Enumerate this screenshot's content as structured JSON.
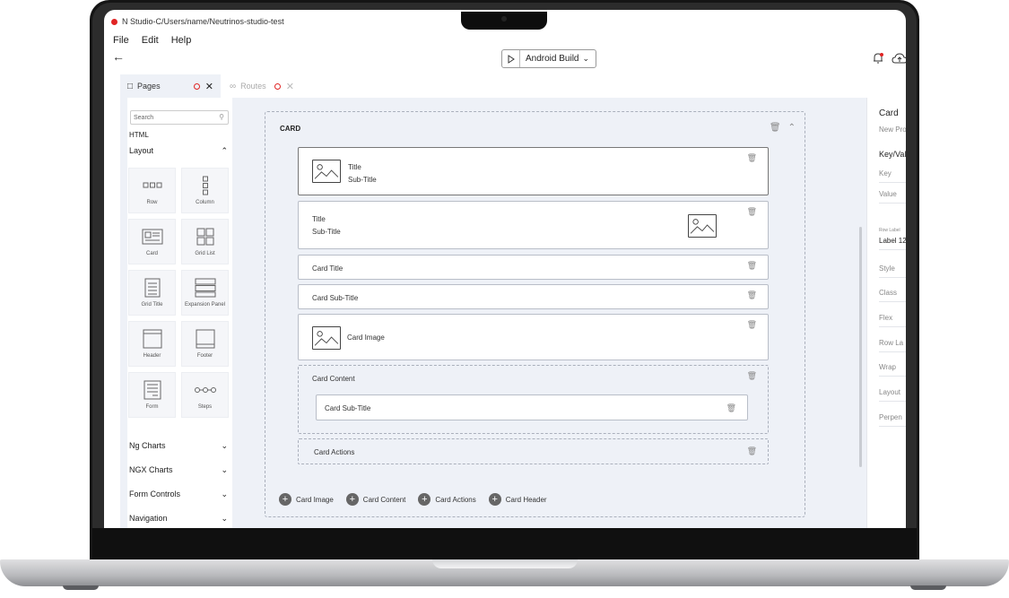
{
  "window": {
    "title": "N Studio-C/Users/name/Neutrinos-studio-test"
  },
  "menu": [
    "File",
    "Edit",
    "Help"
  ],
  "toolbar": {
    "build_label": "Android Build"
  },
  "tabs": [
    {
      "label": "Pages",
      "active": true
    },
    {
      "label": "Routes",
      "active": false
    }
  ],
  "left_panel": {
    "search_placeholder": "Search",
    "html_label": "HTML",
    "layout_label": "Layout",
    "components": [
      "Row",
      "Column",
      "Card",
      "Grid List",
      "Grid Title",
      "Expansion Panel",
      "Header",
      "Footer",
      "Form",
      "Steps"
    ],
    "sections": [
      "Ng Charts",
      "NGX Charts",
      "Form Controls",
      "Navigation"
    ]
  },
  "canvas": {
    "card_label": "CARD",
    "blocks": {
      "header1_title": "Title",
      "header1_subtitle": "Sub-Title",
      "header2_title": "Title",
      "header2_subtitle": "Sub-Title",
      "card_title": "Card Title",
      "card_subtitle": "Card Sub-Title",
      "card_image": "Card Image",
      "card_content": "Card Content",
      "content_subtitle": "Card Sub-Title",
      "card_actions": "Card Actions"
    },
    "add_buttons": [
      "Card Image",
      "Card Content",
      "Card Actions",
      "Card Header"
    ]
  },
  "right_panel": {
    "title": "Card",
    "subtitle": "New Pro",
    "key_value": "Key/Val",
    "key": "Key",
    "value": "Value",
    "row_label_caption": "Row Label",
    "row_label_value": "Label 12",
    "props": [
      "Style",
      "Class",
      "Flex",
      "Row La",
      "Wrap",
      "Layout",
      "Perpen"
    ]
  },
  "colors": {
    "accent_red": "#e02424",
    "canvas_bg": "#eef1f7"
  }
}
